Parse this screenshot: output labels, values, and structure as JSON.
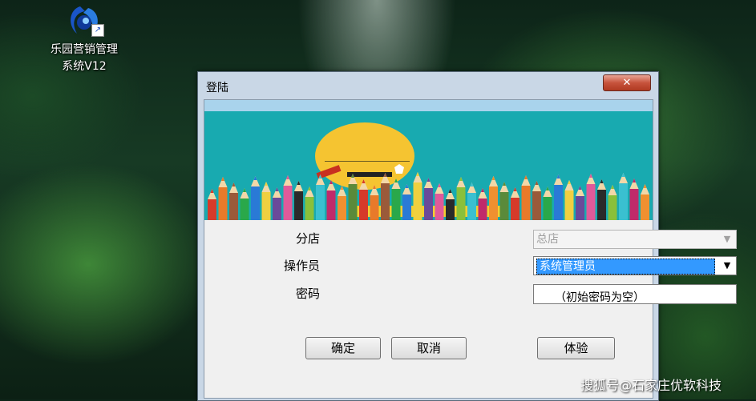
{
  "desktop": {
    "icon": {
      "label_line1": "乐园营销管理",
      "label_line2": "系统V12",
      "icon": "app-logo-icon"
    }
  },
  "dialog": {
    "title": "登陆",
    "close_label": "✕",
    "fields": {
      "store_label": "分店",
      "store_value": "总店",
      "operator_label": "操作员",
      "operator_value": "系统管理员",
      "password_label": "密码",
      "password_value": "",
      "password_hint": "（初始密码为空）"
    },
    "buttons": {
      "ok": "确定",
      "cancel": "取消",
      "trial": "体验"
    }
  },
  "watermark": "搜狐号@石家庄优软科技",
  "colors": {
    "banner_teal": "#18aab0",
    "cloud_yellow": "#f5c431",
    "button_face": "#e4e4e4"
  }
}
